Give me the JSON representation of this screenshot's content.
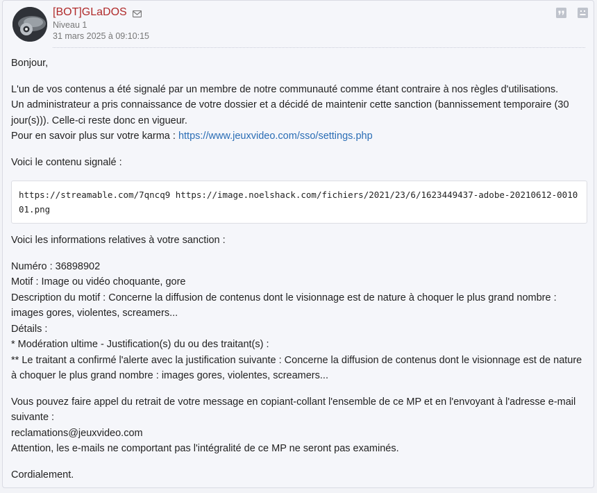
{
  "author": {
    "name": "[BOT]GLaDOS",
    "level": "Niveau 1",
    "date": "31 mars 2025 à 09:10:15"
  },
  "icons": {
    "mail": "envelope-icon",
    "quote": "quote-icon",
    "alert": "alert-icon",
    "colors": {
      "name": "#b02a2a",
      "link": "#2a6db5",
      "icon": "#bfc3cc"
    }
  },
  "message": {
    "greeting": "Bonjour,",
    "para1": [
      "L'un de vos contenus a été signalé par un membre de notre communauté comme étant contraire à nos règles d'utilisations.",
      "Un administrateur a pris connaissance de votre dossier et a décidé de maintenir cette sanction (bannissement temporaire (30 jour(s))). Celle-ci reste donc en vigueur."
    ],
    "karma_prefix": "Pour en savoir plus sur votre karma : ",
    "karma_link": "https://www.jeuxvideo.com/sso/settings.php",
    "reported_intro": "Voici le contenu signalé :",
    "reported_code": "https://streamable.com/7qncq9 https://image.noelshack.com/fichiers/2021/23/6/1623449437-adobe-20210612-001001.png",
    "sanction_intro": "Voici les informations relatives à votre sanction :",
    "sanction": [
      "Numéro : 36898902",
      "Motif : Image ou vidéo choquante, gore",
      "Description du motif : Concerne la diffusion de contenus dont le visionnage est de nature à choquer le plus grand nombre : images gores, violentes, screamers...",
      "Détails :",
      "* Modération ultime - Justification(s) du ou des traitant(s) :",
      "** Le traitant a confirmé l'alerte avec la justification suivante : Concerne la diffusion de contenus dont le visionnage est de nature à choquer le plus grand nombre : images gores, violentes, screamers..."
    ],
    "appeal": [
      "Vous pouvez faire appel du retrait de votre message en copiant-collant l'ensemble de ce MP et en l'envoyant à l'adresse e-mail suivante :",
      "reclamations@jeuxvideo.com",
      "Attention, les e-mails ne comportant pas l'intégralité de ce MP ne seront pas examinés."
    ],
    "closing": "Cordialement."
  }
}
